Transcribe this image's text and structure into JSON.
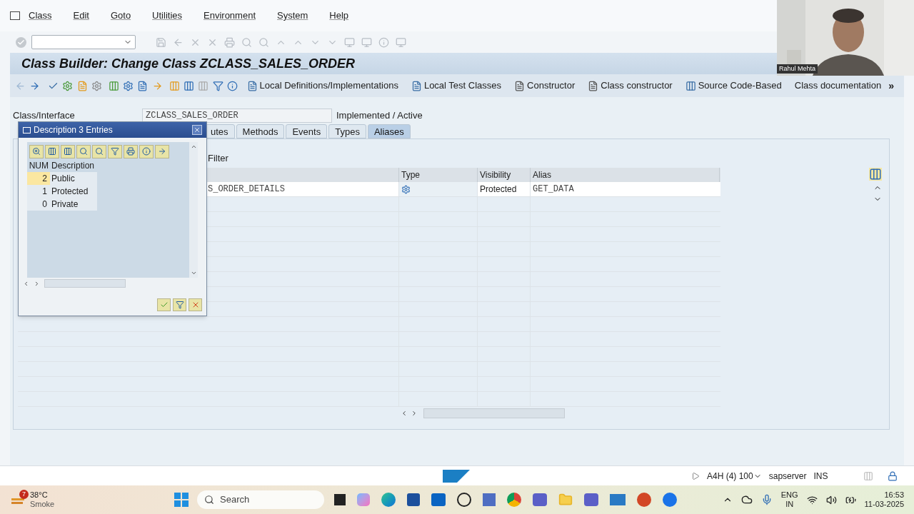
{
  "menu_bar": {
    "items": [
      "Class",
      "Edit",
      "Goto",
      "Utilities",
      "Environment",
      "System",
      "Help"
    ]
  },
  "title": "Class Builder: Change Class ZCLASS_SALES_ORDER",
  "app_toolbar": {
    "buttons": [
      {
        "label": "Local Definitions/Implementations",
        "kind": "list"
      },
      {
        "label": "Local Test Classes",
        "kind": "list"
      },
      {
        "label": "Constructor",
        "kind": "page"
      },
      {
        "label": "Class constructor",
        "kind": "page"
      },
      {
        "label": "Source Code-Based",
        "kind": "swap"
      },
      {
        "label": "Class documentation",
        "kind": "plain"
      }
    ],
    "more": "»"
  },
  "header": {
    "label": "Class/Interface",
    "value": "ZCLASS_SALES_ORDER",
    "status": "Implemented / Active"
  },
  "tabs": [
    {
      "label": "utes",
      "selected": false
    },
    {
      "label": "Methods",
      "selected": false
    },
    {
      "label": "Events",
      "selected": false
    },
    {
      "label": "Types",
      "selected": false
    },
    {
      "label": "Aliases",
      "selected": true
    }
  ],
  "filter_label": "Filter",
  "table": {
    "columns": [
      "Type",
      "Visibility",
      "Alias"
    ],
    "rows": [
      {
        "name": "S_ORDER_DETAILS",
        "visibility": "Protected",
        "alias": "GET_DATA"
      }
    ]
  },
  "popup": {
    "title": "Description 3 Entries",
    "columns": [
      "NUM",
      "Description"
    ],
    "rows": [
      {
        "num": "2",
        "description": "Public",
        "selected": true
      },
      {
        "num": "1",
        "description": "Protected",
        "selected": false
      },
      {
        "num": "0",
        "description": "Private",
        "selected": false
      }
    ]
  },
  "status_bar": {
    "system": "A4H (4) 100",
    "server": "sapserver",
    "mode": "INS"
  },
  "taskbar": {
    "weather": {
      "badge": "7",
      "temp": "38°C",
      "condition": "Smoke"
    },
    "search": "Search",
    "language": [
      "ENG",
      "IN"
    ],
    "time": "16:53",
    "date": "11-03-2025"
  },
  "webcam": {
    "name": "Rahul Mehta"
  }
}
